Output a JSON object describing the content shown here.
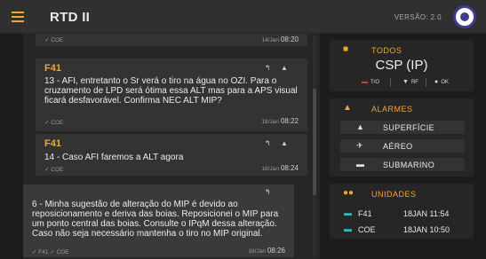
{
  "header": {
    "title": "RTD II",
    "version": "VERSÃO: 2.0",
    "menu_icon": "menu-icon",
    "logo": "navy-logo"
  },
  "chat": {
    "messages": [
      {
        "sender": "",
        "text": "",
        "meta": "✓ COE",
        "time_prefix": "14/Jan",
        "time": "08:20"
      },
      {
        "sender": "F41",
        "text": "13 - AFI, entretanto o Sr verá o tiro na água no OZI. Para o cruzamento de LPD será ótima essa ALT mas para a APS visual ficará desfavorável. Confirma NEC ALT MIP?",
        "meta": "✓ COE",
        "time_prefix": "18/Jan",
        "time": "08:22",
        "actions": [
          "reply-icon",
          "like-icon"
        ]
      },
      {
        "sender": "F41",
        "text": "14 - Caso AFI faremos a ALT agora",
        "meta": "✓ COE",
        "time_prefix": "18/Jan",
        "time": "08:24",
        "actions": [
          "reply-icon",
          "like-icon"
        ]
      },
      {
        "sender": "",
        "text": "6 - Minha sugestão de alteração do MIP é devido ao reposicionamento e deriva das boias. Reposicionei o MIP para um ponto central das boias. Consulte o IPqM dessa alteração. Caso não seja necessário mantenha o tiro no MIP original.",
        "meta": "✓ F41 ✓ COE",
        "time_prefix": "18/Jan",
        "time": "08:26",
        "actions": [
          "reply-icon"
        ]
      }
    ]
  },
  "todos": {
    "title": "TODOS",
    "icon": "person-icon",
    "value": "CSP (IP)",
    "filters": [
      {
        "icon": "red-flag-icon",
        "label": "T/O",
        "color": "#d23b3b"
      },
      {
        "icon": "filter-icon",
        "label": "RF",
        "color": "#e0e0e0"
      },
      {
        "icon": "ok-icon",
        "label": "OK",
        "color": "#e0e0e0"
      }
    ]
  },
  "alarmes": {
    "title": "ALARMES",
    "icon": "bell-icon",
    "items": [
      {
        "icon": "surface-icon",
        "label": "SUPERFÍCIE"
      },
      {
        "icon": "aircraft-icon",
        "label": "AÉREO"
      },
      {
        "icon": "submarine-icon",
        "label": "SUBMARINO"
      }
    ]
  },
  "unidades": {
    "title": "UNIDADES",
    "icon": "group-icon",
    "items": [
      {
        "icon": "ship-icon",
        "name": "F41",
        "datetime": "18JAN 11:54"
      },
      {
        "icon": "ship-icon",
        "name": "COE",
        "datetime": "18JAN 10:50"
      }
    ]
  },
  "colors": {
    "accent": "#f0a830",
    "background": "#1c1c1c",
    "panel": "#262626",
    "card": "#333333",
    "unit_icon": "#35b9c4"
  }
}
